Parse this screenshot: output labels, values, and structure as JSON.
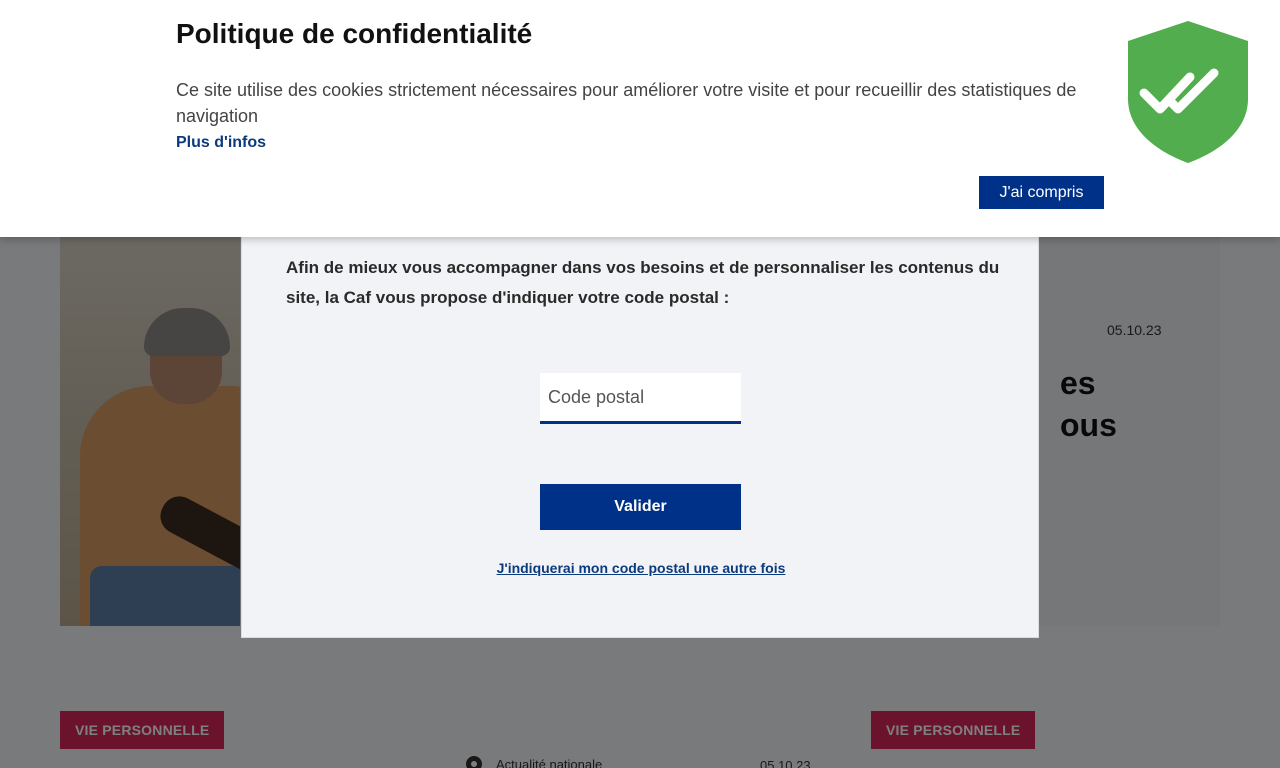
{
  "cookie_banner": {
    "title": "Politique de confidentialité",
    "text": "Ce site utilise des cookies strictement nécessaires pour améliorer votre visite et pour recueillir des statistiques de navigation",
    "more_link": "Plus d'infos",
    "accept_button": "J'ai compris",
    "icon": "shield-check-icon",
    "icon_color": "#52ad4e"
  },
  "postal_modal": {
    "intro": "Afin de mieux vous accompagner dans vos besoins et de personnaliser les contenus du site, la Caf vous propose d'indiquer votre code postal :",
    "input_value": "",
    "input_placeholder": "Code postal",
    "submit_button": "Valider",
    "later_link": "J'indiquerai mon code postal une autre fois"
  },
  "background": {
    "hero": {
      "date": "05.10.23",
      "title_fragment": "es\nous"
    },
    "tags": [
      "VIE PERSONNELLE",
      "VIE PERSONNELLE"
    ],
    "news_item": {
      "category": "Actualité nationale",
      "date": "05.10.23"
    }
  },
  "colors": {
    "primary": "#003189",
    "tag": "#d6265a",
    "link": "#0b3a7e"
  }
}
